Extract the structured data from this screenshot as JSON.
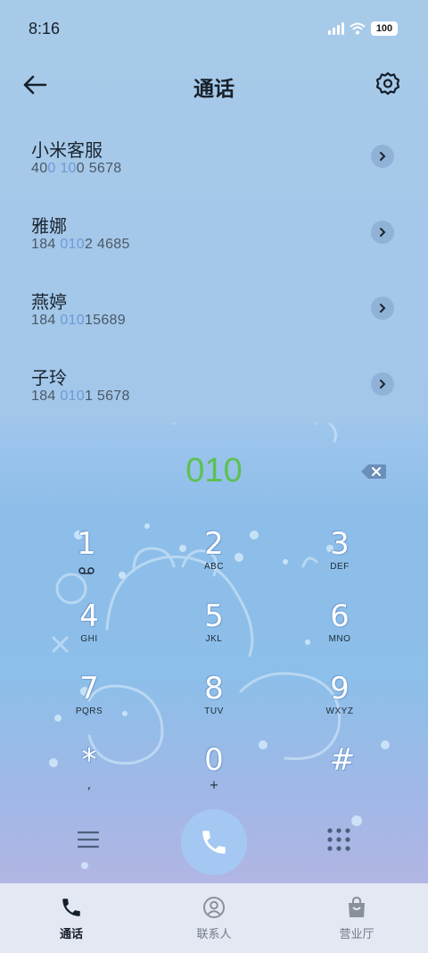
{
  "status_bar": {
    "time": "8:16",
    "battery": "100"
  },
  "header": {
    "title": "通话"
  },
  "contacts": [
    {
      "name": "小米客服",
      "num_parts": [
        "40",
        "0 10",
        "0 5678"
      ]
    },
    {
      "name": "雅娜",
      "num_parts": [
        "184 ",
        "010",
        "2 4685"
      ]
    },
    {
      "name": "燕婷",
      "num_parts": [
        "184 ",
        "010",
        "15689"
      ]
    },
    {
      "name": "子玲",
      "num_parts": [
        "184 ",
        "010",
        "1 5678"
      ]
    }
  ],
  "dialer": {
    "number": "010",
    "keys": [
      {
        "digit": "1",
        "letters": ""
      },
      {
        "digit": "2",
        "letters": "ABC"
      },
      {
        "digit": "3",
        "letters": "DEF"
      },
      {
        "digit": "4",
        "letters": "GHI"
      },
      {
        "digit": "5",
        "letters": "JKL"
      },
      {
        "digit": "6",
        "letters": "MNO"
      },
      {
        "digit": "7",
        "letters": "PQRS"
      },
      {
        "digit": "8",
        "letters": "TUV"
      },
      {
        "digit": "9",
        "letters": "WXYZ"
      },
      {
        "digit": "*",
        "letters": ","
      },
      {
        "digit": "0",
        "letters": "+"
      },
      {
        "digit": "#",
        "letters": ""
      }
    ]
  },
  "tabs": [
    {
      "label": "通话",
      "icon": "phone-icon",
      "active": true
    },
    {
      "label": "联系人",
      "icon": "person-icon",
      "active": false
    },
    {
      "label": "营业厅",
      "icon": "shopping-bag-icon",
      "active": false
    }
  ],
  "colors": {
    "dialed_number": "#5cc152",
    "number_highlight": "#6d9ad6",
    "call_button": "#a4c8f2"
  }
}
